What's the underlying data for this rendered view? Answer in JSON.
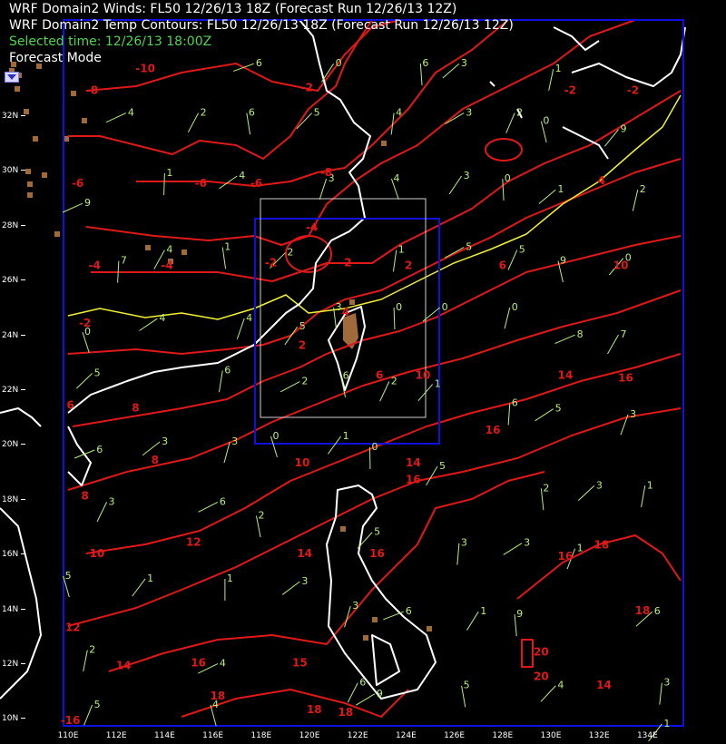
{
  "header": {
    "winds_title": "WRF Domain2 Winds: FL50 12/26/13 18Z (Forecast Run 12/26/13 12Z)",
    "temp_title": "WRF Domain2 Temp Contours: FL50 12/26/13 18Z (Forecast Run 12/26/13 12Z)",
    "selected_time": "Selected time: 12/26/13 18:00Z",
    "mode": "Forecast Mode"
  },
  "axes": {
    "latitudes": [
      "32N",
      "30N",
      "28N",
      "26N",
      "24N",
      "22N",
      "20N",
      "18N",
      "16N",
      "14N",
      "12N",
      "10N"
    ],
    "longitudes": [
      "110E",
      "112E",
      "114E",
      "116E",
      "118E",
      "120E",
      "122E",
      "124E",
      "126E",
      "128E",
      "130E",
      "132E",
      "134E"
    ]
  },
  "colors": {
    "temp_contour": "#e01818",
    "freezing_contour": "#f0f030",
    "coastline": "#ffffff",
    "wind_barb": "#b7f07a",
    "domain_box": "#1010e0",
    "terrain": "#a06a3a"
  },
  "temp_labels": [
    {
      "t": "-10",
      "lat": 33.7,
      "lon": 113.2
    },
    {
      "t": "-8",
      "lat": 32.9,
      "lon": 111.0
    },
    {
      "t": "-2",
      "lat": 33.0,
      "lon": 119.9
    },
    {
      "t": "-2",
      "lat": 32.9,
      "lon": 130.8
    },
    {
      "t": "-2",
      "lat": 32.9,
      "lon": 133.4
    },
    {
      "t": "-6",
      "lat": 29.5,
      "lon": 110.4
    },
    {
      "t": "-6",
      "lat": 29.5,
      "lon": 115.5
    },
    {
      "t": "-6",
      "lat": 29.5,
      "lon": 117.8
    },
    {
      "t": "-8",
      "lat": 29.9,
      "lon": 120.7
    },
    {
      "t": "-4",
      "lat": 27.9,
      "lon": 120.1
    },
    {
      "t": "-2",
      "lat": 26.6,
      "lon": 118.4
    },
    {
      "t": "-2",
      "lat": 26.6,
      "lon": 121.5
    },
    {
      "t": "-4",
      "lat": 26.5,
      "lon": 111.1
    },
    {
      "t": "-4",
      "lat": 26.5,
      "lon": 114.1
    },
    {
      "t": "2",
      "lat": 26.5,
      "lon": 124.1
    },
    {
      "t": "4",
      "lat": 24.8,
      "lon": 121.5
    },
    {
      "t": "4",
      "lat": 29.6,
      "lon": 132.1
    },
    {
      "t": "6",
      "lat": 26.5,
      "lon": 128.0
    },
    {
      "t": "10",
      "lat": 26.5,
      "lon": 132.9
    },
    {
      "t": "-2",
      "lat": 24.4,
      "lon": 110.7
    },
    {
      "t": "2",
      "lat": 23.6,
      "lon": 119.7
    },
    {
      "t": "6",
      "lat": 22.5,
      "lon": 122.9
    },
    {
      "t": "10",
      "lat": 22.5,
      "lon": 124.7
    },
    {
      "t": "14",
      "lat": 22.5,
      "lon": 130.6
    },
    {
      "t": "16",
      "lat": 22.4,
      "lon": 133.1
    },
    {
      "t": "8",
      "lat": 21.3,
      "lon": 112.8
    },
    {
      "t": "16",
      "lat": 20.5,
      "lon": 127.6
    },
    {
      "t": "6",
      "lat": 21.4,
      "lon": 110.1
    },
    {
      "t": "8",
      "lat": 19.4,
      "lon": 113.6
    },
    {
      "t": "10",
      "lat": 19.3,
      "lon": 119.7
    },
    {
      "t": "14",
      "lat": 19.3,
      "lon": 124.3
    },
    {
      "t": "16",
      "lat": 18.7,
      "lon": 124.3
    },
    {
      "t": "8",
      "lat": 18.1,
      "lon": 110.7
    },
    {
      "t": "12",
      "lat": 16.4,
      "lon": 115.2
    },
    {
      "t": "10",
      "lat": 16.0,
      "lon": 111.2
    },
    {
      "t": "14",
      "lat": 16.0,
      "lon": 119.8
    },
    {
      "t": "16",
      "lat": 16.0,
      "lon": 122.8
    },
    {
      "t": "18",
      "lat": 16.3,
      "lon": 132.1
    },
    {
      "t": "16",
      "lat": 15.9,
      "lon": 130.6
    },
    {
      "t": "12",
      "lat": 13.3,
      "lon": 110.2
    },
    {
      "t": "18",
      "lat": 13.9,
      "lon": 133.8
    },
    {
      "t": "14",
      "lat": 11.9,
      "lon": 112.3
    },
    {
      "t": "16",
      "lat": 12.0,
      "lon": 115.4
    },
    {
      "t": "15",
      "lat": 12.0,
      "lon": 119.6
    },
    {
      "t": "20",
      "lat": 12.4,
      "lon": 129.6
    },
    {
      "t": "20",
      "lat": 11.5,
      "lon": 129.6
    },
    {
      "t": "14",
      "lat": 11.2,
      "lon": 132.2
    },
    {
      "t": "18",
      "lat": 10.8,
      "lon": 116.2
    },
    {
      "t": "18",
      "lat": 10.3,
      "lon": 120.2
    },
    {
      "t": "18",
      "lat": 10.2,
      "lon": 121.5
    },
    {
      "t": "-16",
      "lat": 9.9,
      "lon": 110.1
    }
  ],
  "wind_labels": [
    {
      "t": "6",
      "lat": 34.0,
      "lon": 117.7
    },
    {
      "t": "0",
      "lat": 34.0,
      "lon": 121.0
    },
    {
      "t": "6",
      "lat": 34.0,
      "lon": 124.6
    },
    {
      "t": "3",
      "lat": 34.0,
      "lon": 126.2
    },
    {
      "t": "1",
      "lat": 33.8,
      "lon": 130.1
    },
    {
      "t": "4",
      "lat": 32.2,
      "lon": 112.4
    },
    {
      "t": "2",
      "lat": 32.2,
      "lon": 115.4
    },
    {
      "t": "6",
      "lat": 32.2,
      "lon": 117.4
    },
    {
      "t": "5",
      "lat": 32.2,
      "lon": 120.1
    },
    {
      "t": "4",
      "lat": 32.2,
      "lon": 123.5
    },
    {
      "t": "3",
      "lat": 32.2,
      "lon": 126.4
    },
    {
      "t": "2",
      "lat": 32.2,
      "lon": 128.5
    },
    {
      "t": "0",
      "lat": 31.9,
      "lon": 129.6
    },
    {
      "t": "9",
      "lat": 31.6,
      "lon": 132.8
    },
    {
      "t": "1",
      "lat": 30.0,
      "lon": 114.0
    },
    {
      "t": "4",
      "lat": 29.9,
      "lon": 117.0
    },
    {
      "t": "3",
      "lat": 29.8,
      "lon": 120.7
    },
    {
      "t": "4",
      "lat": 29.8,
      "lon": 123.4
    },
    {
      "t": "3",
      "lat": 29.9,
      "lon": 126.3
    },
    {
      "t": "0",
      "lat": 29.8,
      "lon": 128.0
    },
    {
      "t": "1",
      "lat": 29.4,
      "lon": 130.2
    },
    {
      "t": "2",
      "lat": 29.4,
      "lon": 133.6
    },
    {
      "t": "9",
      "lat": 28.9,
      "lon": 110.6
    },
    {
      "t": "4",
      "lat": 27.2,
      "lon": 114.0
    },
    {
      "t": "1",
      "lat": 27.3,
      "lon": 116.4
    },
    {
      "t": "2",
      "lat": 27.1,
      "lon": 119.0
    },
    {
      "t": "1",
      "lat": 27.2,
      "lon": 123.6
    },
    {
      "t": "5",
      "lat": 27.3,
      "lon": 126.4
    },
    {
      "t": "5",
      "lat": 27.2,
      "lon": 128.6
    },
    {
      "t": "9",
      "lat": 26.8,
      "lon": 130.3
    },
    {
      "t": "0",
      "lat": 26.9,
      "lon": 133.0
    },
    {
      "t": "7",
      "lat": 26.8,
      "lon": 112.1
    },
    {
      "t": "4",
      "lat": 24.7,
      "lon": 113.7
    },
    {
      "t": "4",
      "lat": 24.7,
      "lon": 117.3
    },
    {
      "t": "0",
      "lat": 24.2,
      "lon": 110.6
    },
    {
      "t": "5",
      "lat": 24.4,
      "lon": 119.5
    },
    {
      "t": "0",
      "lat": 25.1,
      "lon": 123.5
    },
    {
      "t": "0",
      "lat": 25.1,
      "lon": 125.4
    },
    {
      "t": "0",
      "lat": 25.1,
      "lon": 128.3
    },
    {
      "t": "8",
      "lat": 24.1,
      "lon": 131.0
    },
    {
      "t": "7",
      "lat": 24.1,
      "lon": 132.8
    },
    {
      "t": "3",
      "lat": 25.1,
      "lon": 121.0
    },
    {
      "t": "5",
      "lat": 22.7,
      "lon": 111.0
    },
    {
      "t": "6",
      "lat": 22.8,
      "lon": 116.4
    },
    {
      "t": "2",
      "lat": 22.4,
      "lon": 119.6
    },
    {
      "t": "2",
      "lat": 22.4,
      "lon": 123.3
    },
    {
      "t": "6",
      "lat": 22.6,
      "lon": 121.3
    },
    {
      "t": "1",
      "lat": 22.3,
      "lon": 125.1
    },
    {
      "t": "6",
      "lat": 21.6,
      "lon": 128.3
    },
    {
      "t": "5",
      "lat": 21.4,
      "lon": 130.1
    },
    {
      "t": "3",
      "lat": 21.2,
      "lon": 133.2
    },
    {
      "t": "0",
      "lat": 20.4,
      "lon": 118.4
    },
    {
      "t": "1",
      "lat": 20.4,
      "lon": 121.3
    },
    {
      "t": "0",
      "lat": 20.0,
      "lon": 122.5
    },
    {
      "t": "3",
      "lat": 20.2,
      "lon": 113.8
    },
    {
      "t": "3",
      "lat": 20.2,
      "lon": 116.7
    },
    {
      "t": "6",
      "lat": 19.9,
      "lon": 111.1
    },
    {
      "t": "5",
      "lat": 19.3,
      "lon": 125.3
    },
    {
      "t": "2",
      "lat": 18.5,
      "lon": 129.6
    },
    {
      "t": "3",
      "lat": 18.6,
      "lon": 131.8
    },
    {
      "t": "1",
      "lat": 18.6,
      "lon": 133.9
    },
    {
      "t": "6",
      "lat": 18.0,
      "lon": 116.2
    },
    {
      "t": "3",
      "lat": 18.0,
      "lon": 111.6
    },
    {
      "t": "2",
      "lat": 17.5,
      "lon": 117.8
    },
    {
      "t": "5",
      "lat": 16.9,
      "lon": 122.6
    },
    {
      "t": "3",
      "lat": 16.5,
      "lon": 126.2
    },
    {
      "t": "3",
      "lat": 16.5,
      "lon": 128.8
    },
    {
      "t": "1",
      "lat": 16.3,
      "lon": 131.0
    },
    {
      "t": "5",
      "lat": 15.3,
      "lon": 109.8
    },
    {
      "t": "1",
      "lat": 15.2,
      "lon": 113.2
    },
    {
      "t": "1",
      "lat": 15.2,
      "lon": 116.5
    },
    {
      "t": "3",
      "lat": 15.1,
      "lon": 119.6
    },
    {
      "t": "3",
      "lat": 14.2,
      "lon": 121.7
    },
    {
      "t": "6",
      "lat": 14.0,
      "lon": 123.9
    },
    {
      "t": "1",
      "lat": 14.0,
      "lon": 127.0
    },
    {
      "t": "9",
      "lat": 13.9,
      "lon": 128.5
    },
    {
      "t": "6",
      "lat": 14.0,
      "lon": 134.2
    },
    {
      "t": "2",
      "lat": 12.6,
      "lon": 110.8
    },
    {
      "t": "4",
      "lat": 12.1,
      "lon": 116.2
    },
    {
      "t": "6",
      "lat": 11.4,
      "lon": 122.0
    },
    {
      "t": "5",
      "lat": 11.3,
      "lon": 126.3
    },
    {
      "t": "4",
      "lat": 11.3,
      "lon": 130.2
    },
    {
      "t": "3",
      "lat": 11.4,
      "lon": 134.6
    },
    {
      "t": "9",
      "lat": 11.0,
      "lon": 122.7
    },
    {
      "t": "5",
      "lat": 10.6,
      "lon": 111.0
    },
    {
      "t": "4",
      "lat": 10.6,
      "lon": 115.9
    },
    {
      "t": "1",
      "lat": 9.9,
      "lon": 134.6
    }
  ]
}
